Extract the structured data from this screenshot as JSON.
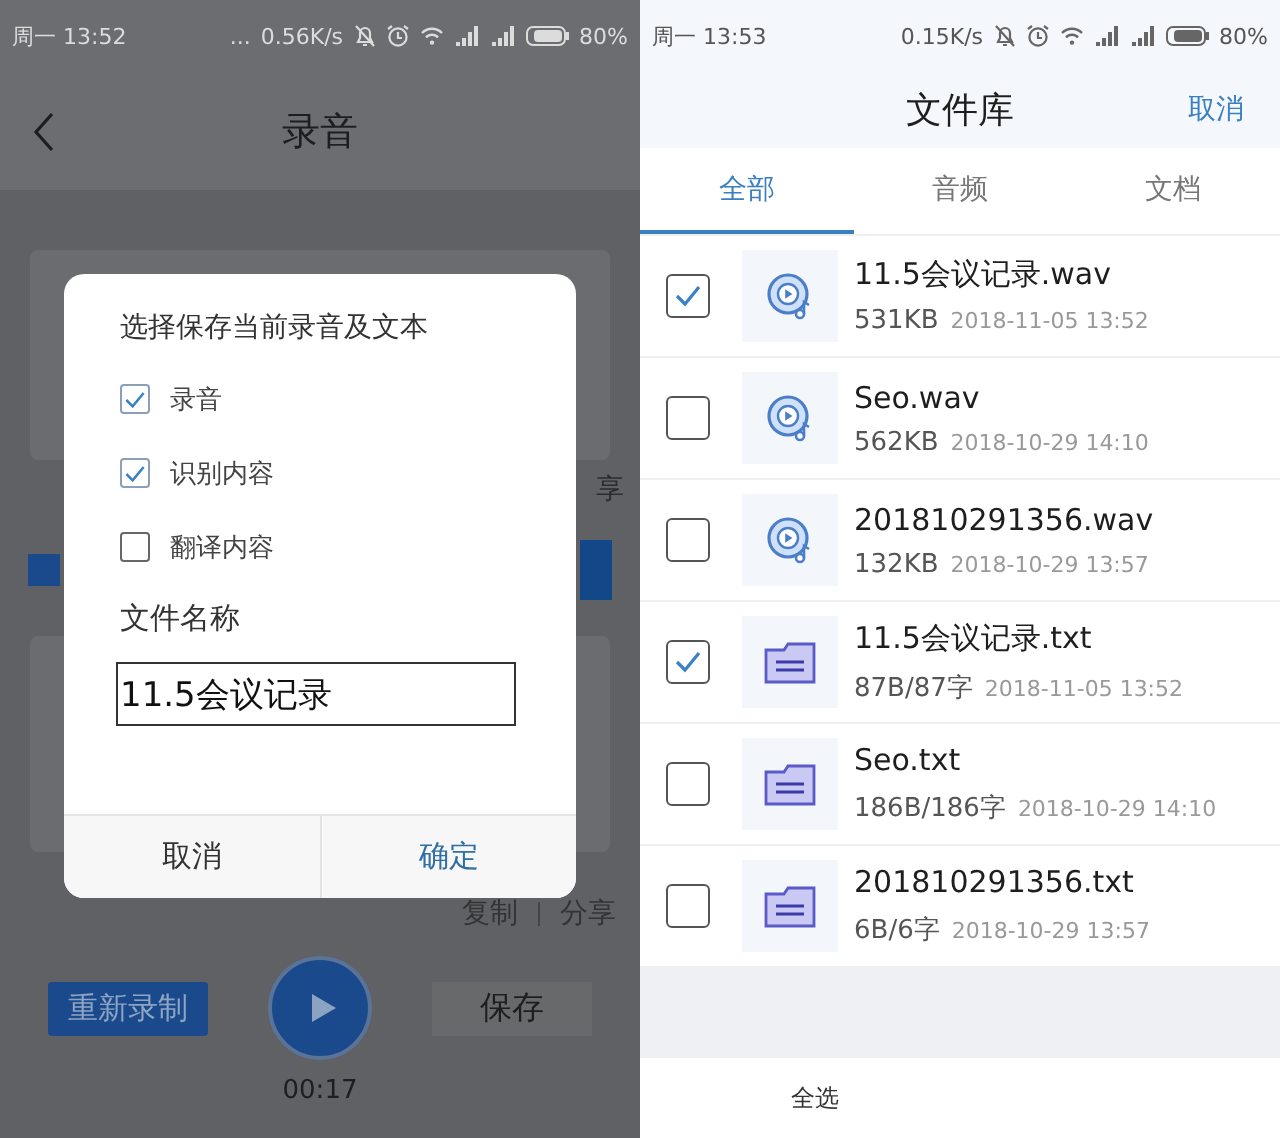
{
  "left_screen": {
    "status_bar": {
      "time": "周一 13:52",
      "more": "...",
      "speed": "0.56K/s",
      "battery": "80%"
    },
    "header": {
      "title": "录音"
    },
    "share_fragment": "享",
    "dialog": {
      "title": "选择保存当前录音及文本",
      "options": [
        {
          "label": "录音",
          "checked": true
        },
        {
          "label": "识别内容",
          "checked": true
        },
        {
          "label": "翻译内容",
          "checked": false
        }
      ],
      "filename_label": "文件名称",
      "filename_value": "11.5会议记录",
      "cancel": "取消",
      "confirm": "确定"
    },
    "actions": [
      "复制",
      "分享"
    ],
    "rerecord": "重新录制",
    "save": "保存",
    "elapsed": "00:17"
  },
  "right_screen": {
    "status_bar": {
      "time": "周一 13:53",
      "speed": "0.15K/s",
      "battery": "80%"
    },
    "header": {
      "title": "文件库",
      "cancel": "取消"
    },
    "tabs": [
      {
        "label": "全部",
        "selected": true
      },
      {
        "label": "音频",
        "selected": false
      },
      {
        "label": "文档",
        "selected": false
      }
    ],
    "files": [
      {
        "kind": "audio",
        "name": "11.5会议记录.wav",
        "size": "531KB",
        "date": "2018-11-05 13:52",
        "checked": true
      },
      {
        "kind": "audio",
        "name": "Seo.wav",
        "size": "562KB",
        "date": "2018-10-29 14:10",
        "checked": false
      },
      {
        "kind": "audio",
        "name": "201810291356.wav",
        "size": "132KB",
        "date": "2018-10-29 13:57",
        "checked": false
      },
      {
        "kind": "text",
        "name": "11.5会议记录.txt",
        "size": "87B/87字",
        "date": "2018-11-05 13:52",
        "checked": true
      },
      {
        "kind": "text",
        "name": "Seo.txt",
        "size": "186B/186字",
        "date": "2018-10-29 14:10",
        "checked": false
      },
      {
        "kind": "text",
        "name": "201810291356.txt",
        "size": "6B/6字",
        "date": "2018-10-29 13:57",
        "checked": false
      }
    ],
    "footer": {
      "select_all": "全选"
    }
  }
}
